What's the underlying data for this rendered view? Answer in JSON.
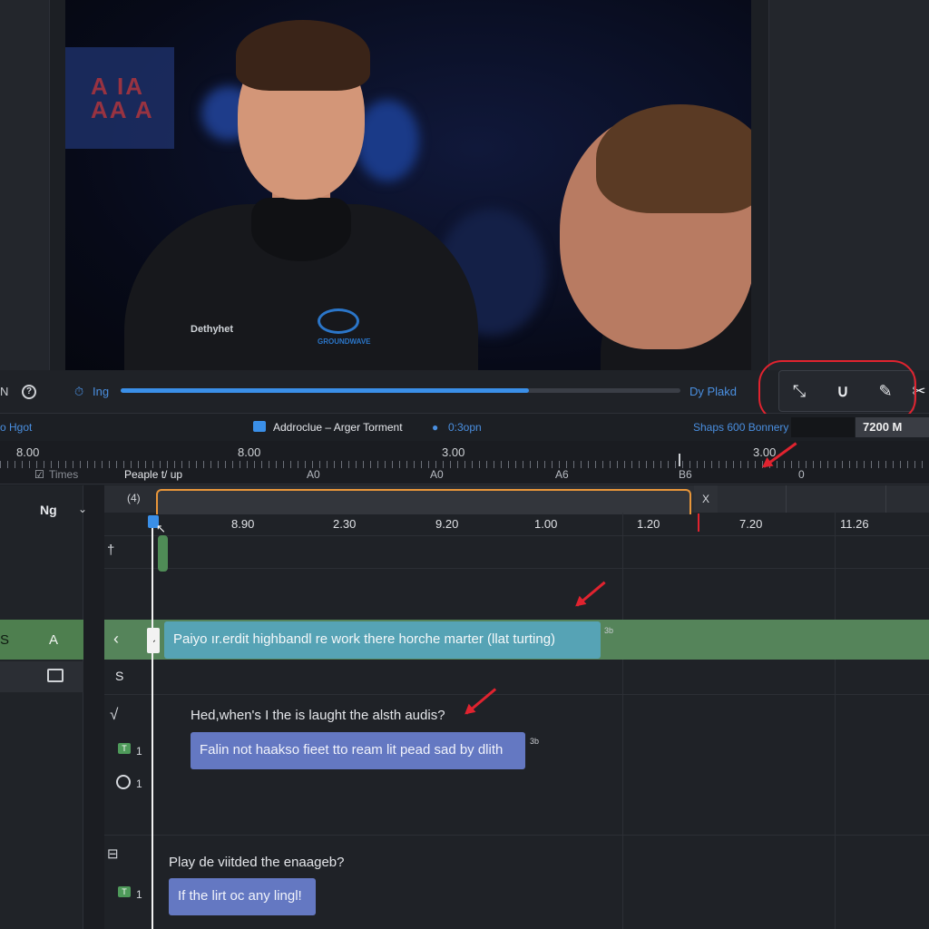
{
  "viewer": {
    "shirt_brand": "Dethyhet",
    "shirt_logo_text": "GROUNDWAVE"
  },
  "transport": {
    "left_label": "N",
    "help_glyph": "?",
    "time_label": "Ing",
    "right_label": "Dy Plakd",
    "tools": [
      "pointer-tool",
      "magnet-tool",
      "pen-tool"
    ],
    "progress_percent": 73
  },
  "info_row": {
    "left": "o Hgot",
    "project": "Addroclue – Arger Torment",
    "user_time": "0:3opn",
    "memory": "Shaps 600 Bonnery",
    "size": "7200 M"
  },
  "ruler": {
    "numbers": [
      "8.00",
      "8.00",
      "3.00",
      "3.00"
    ],
    "times_label": "Times",
    "people_label": "Peaple t/ up",
    "marks": [
      "A0",
      "A0",
      "A6",
      "B6",
      "0"
    ]
  },
  "timeline": {
    "track_name": "Ng",
    "header_glyph": "(4)",
    "close_label": "X",
    "timecodes": [
      "8.90",
      "2.30",
      "9.20",
      "1.00",
      "1.20",
      "7.20",
      "11.26"
    ],
    "track_a_left": "S",
    "track_a_label": "A",
    "track_s_label": "S",
    "clip_icon_1": "†",
    "audio_icon": "√",
    "caption_1": "Paiyo ır.erdit highbandl re work there horche marter (llat turting)",
    "caption_1_tag": "3b",
    "question_1": "Hed,when's I the is laught the alsth audis?",
    "caption_2": "Falin not haakso fieet tto ream lit pead sad by dlith",
    "caption_2_tag": "3b",
    "badge_1": "1",
    "badge_2": "1",
    "question_2": "Play de viitded the enaageb?",
    "caption_3": "If the lirt oc any lingl!",
    "badge_3": "1"
  },
  "colors": {
    "accent_blue": "#3a8fe8",
    "annotation_red": "#e0232f",
    "range_orange": "#e8963a",
    "caption_teal": "#56a3b5",
    "caption_purple": "#6478c2",
    "track_green": "#55845a"
  }
}
